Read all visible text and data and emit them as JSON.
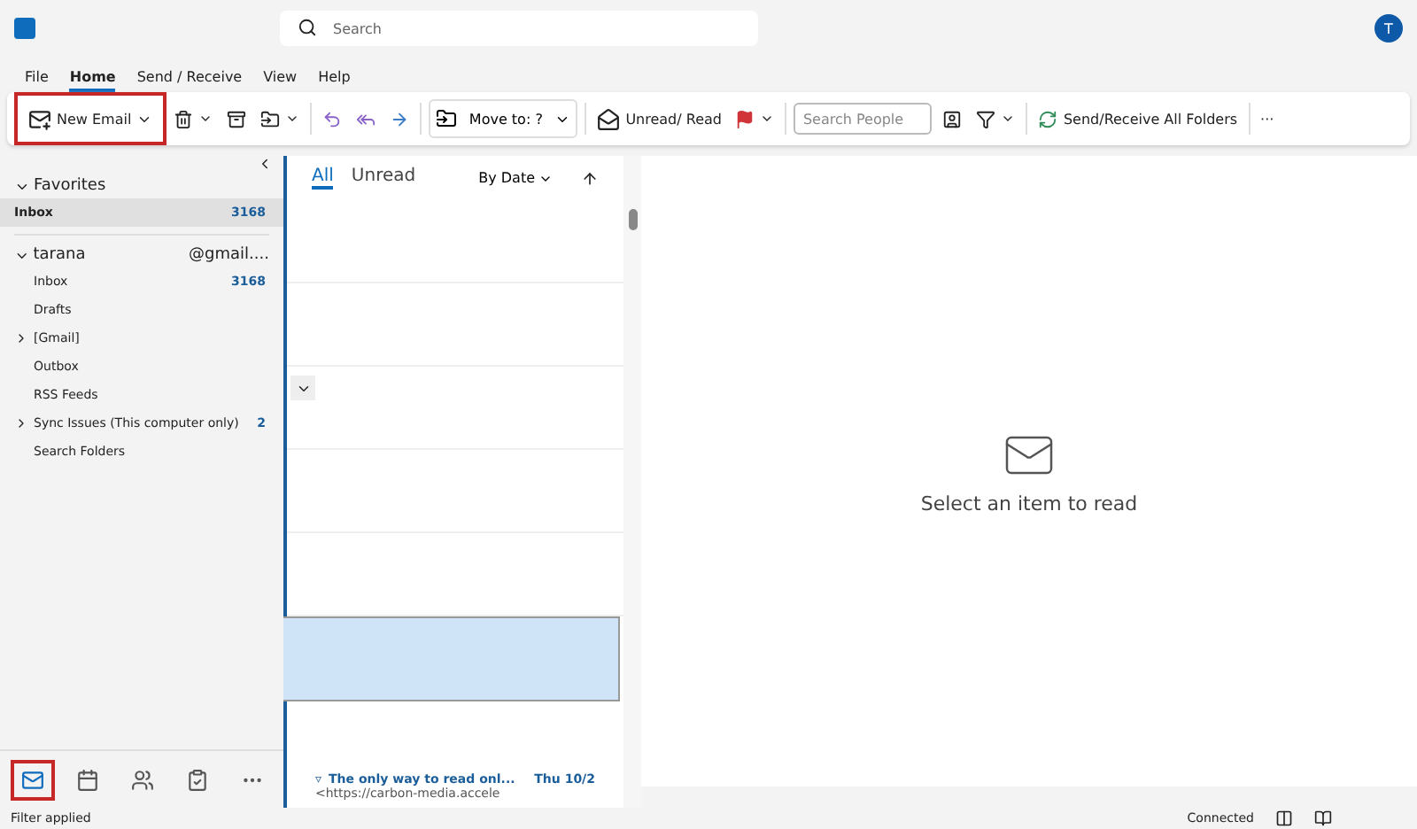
{
  "titlebar": {
    "search": {
      "placeholder": "Search"
    },
    "avatar": "T"
  },
  "menu_tabs": [
    {
      "label": "File",
      "selected": false
    },
    {
      "label": "Home",
      "selected": true
    },
    {
      "label": "Send / Receive",
      "selected": false
    },
    {
      "label": "View",
      "selected": false
    },
    {
      "label": "Help",
      "selected": false
    }
  ],
  "ribbon": {
    "new_email": "New Email",
    "move_to": "Move to: ?",
    "unread_read": "Unread/ Read",
    "search_people": {
      "placeholder": "Search People"
    },
    "send_receive": "Send/Receive All Folders",
    "more": "···"
  },
  "favorites": {
    "title": "Favorites",
    "items": [
      {
        "label": "Inbox",
        "count": "3168",
        "selected": true
      }
    ]
  },
  "account": {
    "name_start": "tarana",
    "name_end": "@gmail....",
    "folders": [
      {
        "label": "Inbox",
        "count": "3168",
        "expandable": false
      },
      {
        "label": "Drafts",
        "expandable": false
      },
      {
        "label": "[Gmail]",
        "expandable": true
      },
      {
        "label": "Outbox",
        "expandable": false
      },
      {
        "label": "RSS Feeds",
        "expandable": false
      },
      {
        "label": "Sync Issues (This computer only)",
        "count": "2",
        "expandable": true
      },
      {
        "label": "Search Folders",
        "expandable": false
      }
    ]
  },
  "list_tabs": [
    {
      "label": "All",
      "selected": true
    },
    {
      "label": "Unread",
      "selected": false
    }
  ],
  "sort": "By Date",
  "messages": [
    {
      "marker": "▿",
      "subject": "The only way to read onl...",
      "date": "Thu 10/2",
      "preview": "<https://carbon-media.accele"
    }
  ],
  "reading_pane": {
    "empty_text": "Select an item to read"
  },
  "nav": [
    {
      "kind": "mail",
      "selected": true
    },
    {
      "kind": "calendar",
      "selected": false
    },
    {
      "kind": "people",
      "selected": false
    },
    {
      "kind": "tasks",
      "selected": false
    },
    {
      "kind": "more",
      "selected": false
    }
  ],
  "status_bar": {
    "left": "Filter applied",
    "right": "Connected"
  }
}
